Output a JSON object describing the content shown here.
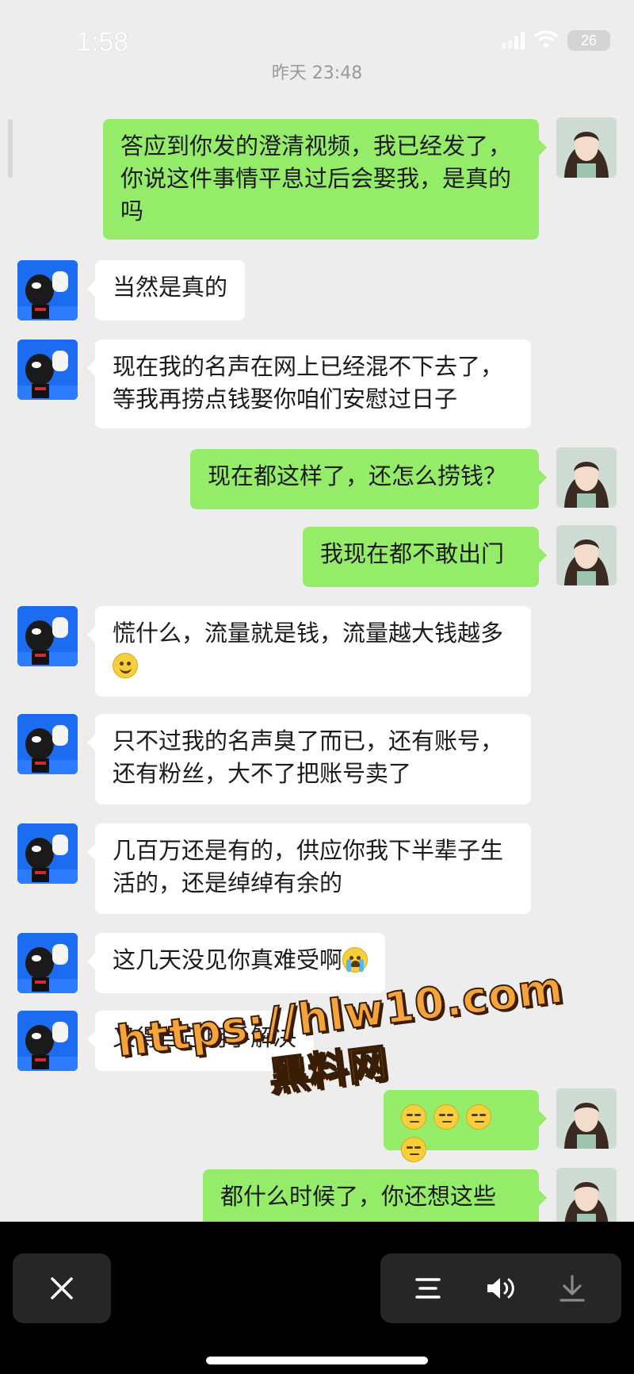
{
  "status_bar": {
    "time": "1:58",
    "battery": "26"
  },
  "chat": {
    "timestamp": "昨天 23:48",
    "messages": [
      {
        "side": "out",
        "text": "答应到你发的澄清视频，我已经发了，你说这件事情平息过后会娶我，是真的吗"
      },
      {
        "side": "in",
        "text": "当然是真的"
      },
      {
        "side": "in",
        "text": "现在我的名声在网上已经混不下去了，等我再捞点钱娶你咱们安慰过日子"
      },
      {
        "side": "out",
        "text": "现在都这样了，还怎么捞钱？"
      },
      {
        "side": "out",
        "text": "我现在都不敢出门"
      },
      {
        "side": "in",
        "text": "慌什么，流量就是钱，流量越大钱越多",
        "emoji": "smile-emoji"
      },
      {
        "side": "in",
        "text": "只不过我的名声臭了而已，还有账号，还有粉丝，大不了把账号卖了"
      },
      {
        "side": "in",
        "text": "几百万还是有的，供应你我下半辈子生活的，还是绰绰有余的"
      },
      {
        "side": "in",
        "text": "这几天没见你真难受啊",
        "emoji": "crying-emoji"
      },
      {
        "side": "in",
        "text": "又得自己用手解决"
      },
      {
        "side": "out",
        "text": "",
        "emoji": "smirk-emoji x4"
      },
      {
        "side": "out",
        "text": "都什么时候了，你还想这些"
      }
    ]
  },
  "watermark": {
    "url": "https://hlw10.com",
    "name": "黑料网"
  },
  "colors": {
    "background": "#ededed",
    "outgoing_bubble": "#95ec69",
    "incoming_bubble": "#ffffff",
    "watermark": "#f6a43a"
  },
  "toolbar": {
    "close_icon": "close-icon",
    "menu_icon": "menu-icon",
    "volume_icon": "volume-icon",
    "download_icon": "download-icon"
  }
}
